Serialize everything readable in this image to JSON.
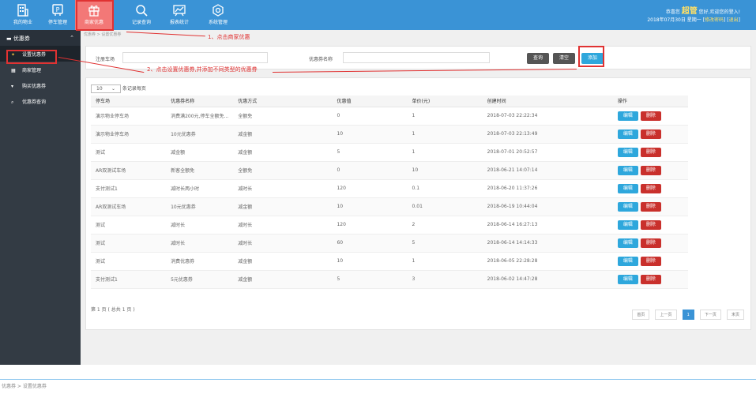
{
  "topnav": {
    "items": [
      {
        "label": "我的物业",
        "icon": "building-icon"
      },
      {
        "label": "停车管理",
        "icon": "parking-icon"
      },
      {
        "label": "商家优惠",
        "icon": "gift-icon"
      },
      {
        "label": "记录查询",
        "icon": "search-icon"
      },
      {
        "label": "报表统计",
        "icon": "chart-icon"
      },
      {
        "label": "系统管理",
        "icon": "gear-icon"
      }
    ],
    "welcome_prefix": "恭喜您",
    "user": "超管",
    "welcome_suffix": "您好,欢迎您的登入!",
    "date": "2018年07月30日 星期一",
    "change_pwd": "修改密码",
    "logout": "退出"
  },
  "sidebar": {
    "section": "优惠券",
    "items": [
      {
        "label": "设置优惠券",
        "icon": "pin-icon"
      },
      {
        "label": "商家管理",
        "icon": "bank-icon"
      },
      {
        "label": "购买优惠券",
        "icon": "cart-icon"
      },
      {
        "label": "优惠券查询",
        "icon": "search-icon"
      }
    ]
  },
  "breadcrumb": {
    "part1": "优惠券",
    "part2": "设置优惠券"
  },
  "filter": {
    "lot_label": "注册车场",
    "name_label": "优惠券名称",
    "search_btn": "查询",
    "clear_btn": "清空",
    "add_btn": "添加"
  },
  "list": {
    "page_size": "10",
    "page_size_suffix": "条记录每页",
    "columns": [
      "停车场",
      "优惠券名称",
      "优惠方式",
      "优惠值",
      "单价(元)",
      "创建时间",
      "操作"
    ],
    "rows": [
      [
        "演示物业停车场",
        "消费满200元,停车全额免...",
        "全额免",
        "0",
        "1",
        "2018-07-03 22:22:34"
      ],
      [
        "演示物业停车场",
        "10元优惠券",
        "减金额",
        "10",
        "1",
        "2018-07-03 22:13:49"
      ],
      [
        "测试",
        "减金额",
        "减金额",
        "5",
        "1",
        "2018-07-01 20:52:57"
      ],
      [
        "AR双测试车场",
        "新客全额免",
        "全额免",
        "0",
        "10",
        "2018-06-21 14:07:14"
      ],
      [
        "支付测试1",
        "减时长两小时",
        "减时长",
        "120",
        "0.1",
        "2018-06-20 11:37:26"
      ],
      [
        "AR双测试车场",
        "10元优惠券",
        "减金额",
        "10",
        "0.01",
        "2018-06-19 10:44:04"
      ],
      [
        "测试",
        "减时长",
        "减时长",
        "120",
        "2",
        "2018-06-14 16:27:13"
      ],
      [
        "测试",
        "减时长",
        "减时长",
        "60",
        "5",
        "2018-06-14 14:14:33"
      ],
      [
        "测试",
        "消费优惠券",
        "减金额",
        "10",
        "1",
        "2018-06-05 22:28:28"
      ],
      [
        "支付测试1",
        "5元优惠券",
        "减金额",
        "5",
        "3",
        "2018-06-02 14:47:28"
      ]
    ],
    "edit_label": "编辑",
    "delete_label": "删除",
    "page_info": "第 1 页 ( 总共 1 页 )"
  },
  "pager": {
    "first": "首页",
    "prev": "上一页",
    "current": "1",
    "next": "下一页",
    "last": "末页"
  },
  "annotations": {
    "step1": "1、点击商家优惠",
    "step2": "2、点击设置优惠券,并添加不同类型的优惠券"
  },
  "footer_breadcrumb": "优惠券 > 设置优惠券"
}
